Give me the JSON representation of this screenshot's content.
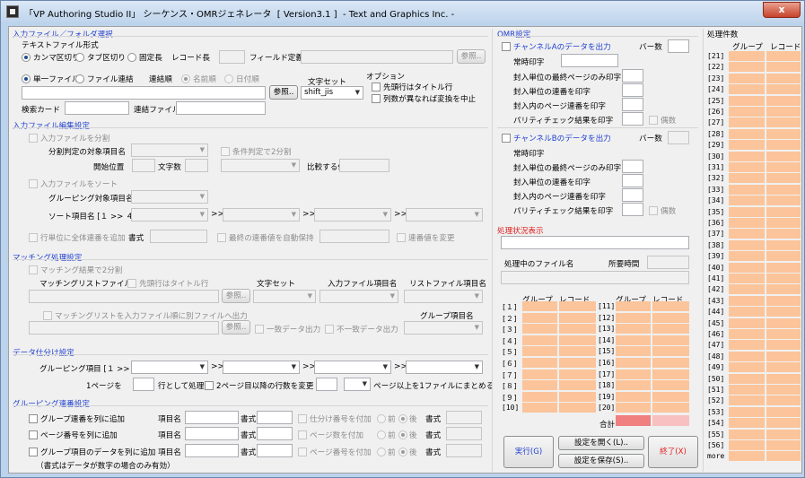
{
  "window": {
    "title": "「VP Authoring Studio II」 シーケンス・OMRジェネレータ  [ Version3.1 ]  - Text and Graphics Inc. -",
    "close": "x"
  },
  "input": {
    "section": "入力ファイル／フォルダ選択",
    "format_label": "テキストファイル形式",
    "comma": "カンマ区切り",
    "tab": "タブ区切り",
    "fixed": "固定長",
    "record_length_label": "レコード長",
    "field_def_label": "フィールド定義",
    "browse": "参照..",
    "single_file": "単一ファイル",
    "concat": "ファイル連結",
    "concat_order": "連結順",
    "by_name": "名前順",
    "by_date": "日付順",
    "charset_label": "文字セット",
    "charset_value": "shift_jis",
    "options_label": "オプション",
    "opt_title_row": "先頭行はタイトル行",
    "opt_col_mismatch": "列数が異なれば変換を中止",
    "search_card": "検索カード",
    "concat_filename": "連結ファイル名"
  },
  "edit": {
    "section": "入力ファイル編集設定",
    "split": "入力ファイルを分割",
    "split_key": "分割判定の対象項目名",
    "cond_split": "条件判定で2分割",
    "start_pos": "開始位置",
    "chars": "文字数",
    "compare_value": "比較する値",
    "sort": "入力ファイルをソート",
    "group_key": "グルーピング対象項目名",
    "sort_keys": "ソート項目名 [１ >> ４ ]",
    "add_serial": "行単位に全体連番を追加",
    "format": "書式",
    "keep_last": "最終の連番値を自動保持",
    "change_serial": "連番値を変更"
  },
  "matching": {
    "section": "マッチング処理設定",
    "split2": "マッチング結果で2分割",
    "list_file": "マッチングリストファイル",
    "title_row": "先頭行はタイトル行",
    "charset": "文字セット",
    "input_key": "入力ファイル項目名",
    "list_key": "リストファイル項目名",
    "browse": "参照..",
    "output_sep": "マッチングリストを入力ファイル順に別ファイルへ出力",
    "group_key": "グループ項目名",
    "match_out": "一致データ出力",
    "unmatch_out": "不一致データ出力"
  },
  "split": {
    "section": "データ仕分け設定",
    "group_items": "グルーピング項目 [１ >> ４ ]",
    "per_page_pre": "1ページを",
    "per_page_mid": "行として処理",
    "change_rows": "2ページ目以降の行数を変更",
    "pages_post": "ページ以上を1ファイルにまとめる"
  },
  "serial": {
    "section": "グルーピング連番設定",
    "g_serial": "グループ連番を列に追加",
    "p_serial": "ページ番号を列に追加",
    "g_data": "グループ項目のデータを列に追加",
    "item_name": "項目名",
    "format": "書式",
    "add_sort_no": "仕分け番号を付加",
    "add_page_count": "ページ数を付加",
    "add_page_no": "ページ番号を付加",
    "before": "前",
    "after": "後",
    "note": "（書式はデータが数字の場合のみ有効）"
  },
  "omr": {
    "section": "OMR設定",
    "ch_a": "チャンネルAのデータを出力",
    "ch_b": "チャンネルBのデータを出力",
    "bars": "バー数",
    "always": "常時印字",
    "last_page_only": "封入単位の最終ページのみ印字",
    "unit_serial": "封入単位の連番を印字",
    "inner_serial": "封入内のページ連番を印字",
    "parity": "パリティチェック結果を印字",
    "even": "偶数"
  },
  "status": {
    "section": "処理状況表示",
    "current_file": "処理中のファイル名",
    "elapsed": "所要時間",
    "group": "グループ",
    "record": "レコード",
    "total": "合計",
    "rows_left": [
      "[１]",
      "[２]",
      "[３]",
      "[４]",
      "[５]",
      "[６]",
      "[７]",
      "[８]",
      "[９]",
      "[10]"
    ],
    "rows_right": [
      "[11]",
      "[12]",
      "[13]",
      "[14]",
      "[15]",
      "[16]",
      "[17]",
      "[18]",
      "[19]",
      "[20]"
    ]
  },
  "buttons": {
    "run": "実行(G)",
    "open_settings": "設定を開く(L)..",
    "save_settings": "設定を保存(S)..",
    "exit": "終了(X)"
  },
  "counts": {
    "title": "処理件数",
    "group": "グループ",
    "record": "レコード",
    "rows": [
      "[21]",
      "[22]",
      "[23]",
      "[24]",
      "[25]",
      "[26]",
      "[27]",
      "[28]",
      "[29]",
      "[30]",
      "[31]",
      "[32]",
      "[33]",
      "[34]",
      "[35]",
      "[36]",
      "[37]",
      "[38]",
      "[39]",
      "[40]",
      "[41]",
      "[42]",
      "[43]",
      "[44]",
      "[45]",
      "[46]",
      "[47]",
      "[48]",
      "[49]",
      "[50]",
      "[51]",
      "[52]",
      "[53]",
      "[54]",
      "[55]",
      "[56]",
      "more"
    ]
  },
  "colors": {
    "accent_text": "#1f3fd0",
    "peach": "#fbc49a",
    "total_red": "#f08080",
    "total_pink": "#f8c0c0",
    "exit_red": "#e02020"
  }
}
